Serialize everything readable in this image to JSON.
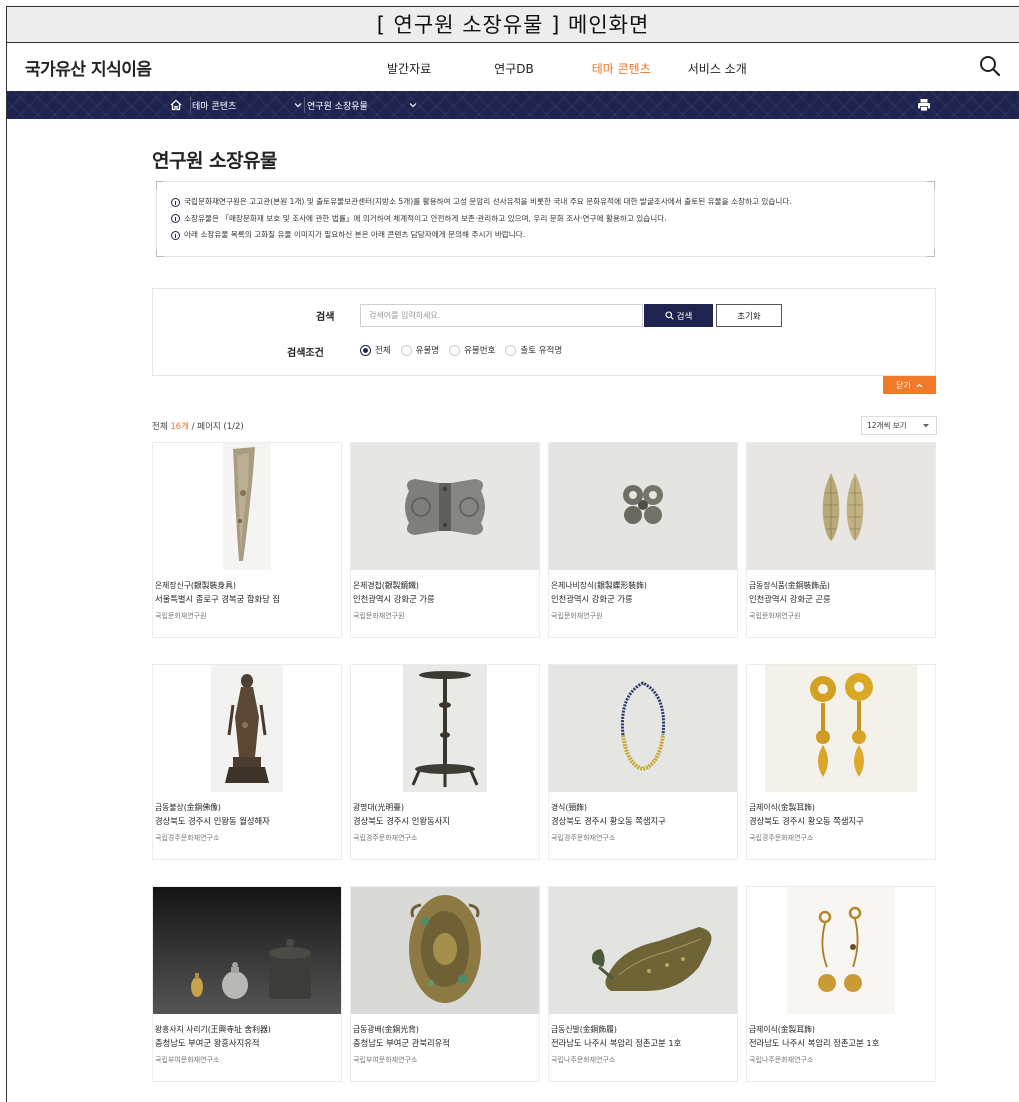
{
  "frame_title": "[ 연구원 소장유물 ] 메인화면",
  "logo": "국가유산 지식이음",
  "gnb": [
    {
      "label": "발간자료",
      "active": false
    },
    {
      "label": "연구DB",
      "active": false
    },
    {
      "label": "테마 콘텐츠",
      "active": true
    },
    {
      "label": "서비스 소개",
      "active": false
    }
  ],
  "location": {
    "dropdown1": "테마 콘텐츠",
    "dropdown2": "연구원 소장유물"
  },
  "page_title": "연구원 소장유물",
  "notice": [
    "국립문화재연구원은 고고관(본원 1개) 및 출토유물보관센터(지방소 5개)를 활용하여 고성 문암리 선사유적을 비롯한 국내 주요 문화유적에 대한 발굴조사에서 출토된 유물을 소장하고 있습니다.",
    "소장유물은 「매장문화재 보호 및 조사에 관한 법률」에 의거하여 체계적이고 안전하게 보존·관리하고 있으며, 우리 문화 조사·연구에 활용하고 있습니다.",
    "아래 소장유물 목록의 고화질 유물 이미지가 필요하신 분은 아래 콘텐츠 담당자에게 문의해 주시기 바랍니다."
  ],
  "search": {
    "label": "검색",
    "placeholder": "검색어를 입력하세요.",
    "search_button": "검색",
    "reset_button": "초기화",
    "condition_label": "검색조건",
    "conditions": [
      "전체",
      "유물명",
      "유물번호",
      "출토 유적명"
    ],
    "selected": "전체"
  },
  "close_button": "닫기",
  "total": {
    "prefix": "전체 ",
    "count": "16개",
    "suffix": " / 페이지 (1/2)"
  },
  "per_page": "12개씩 보기",
  "items": [
    {
      "title": "은제장신구(銀製裝身具)",
      "place": "서울특별시 종로구 경복궁 함화당 집",
      "inst": "국립문화재연구원"
    },
    {
      "title": "은제경첩(銀製鏡鐵)",
      "place": "인천광역시 강화군 가릉",
      "inst": "국립문화재연구원"
    },
    {
      "title": "은제나비장식(銀製蝶形裝飾)",
      "place": "인천광역시 강화군 가릉",
      "inst": "국립문화재연구원"
    },
    {
      "title": "금동장식품(金銅裝飾品)",
      "place": "인천광역시 강화군 곤릉",
      "inst": "국립문화재연구원"
    },
    {
      "title": "금동불상(金銅佛像)",
      "place": "경상북도 경주시 인왕동 월성해자",
      "inst": "국립경주문화재연구소"
    },
    {
      "title": "광명대(光明臺)",
      "place": "경상북도 경주시 인왕동사지",
      "inst": "국립경주문화재연구소"
    },
    {
      "title": "경식(頸飾)",
      "place": "경상북도 경주시 황오동 쪽샘지구",
      "inst": "국립경주문화재연구소"
    },
    {
      "title": "금제이식(金製耳飾)",
      "place": "경상북도 경주시 황오동 쪽샘지구",
      "inst": "국립경주문화재연구소"
    },
    {
      "title": "왕흥사지 사리기(王興寺址 舍利器)",
      "place": "충청남도 부여군 왕흥사지유적",
      "inst": "국립부여문화재연구소"
    },
    {
      "title": "금동광배(金銅光背)",
      "place": "충청남도 부여군 관북리유적",
      "inst": "국립부여문화재연구소"
    },
    {
      "title": "금동신발(金銅飾履)",
      "place": "전라남도 나주시 복암리 정촌고분 1호",
      "inst": "국립나주문화재연구소"
    },
    {
      "title": "금제이식(金製耳飾)",
      "place": "전라남도 나주시 복암리 정촌고분 1호",
      "inst": "국립나주문화재연구소"
    }
  ],
  "colors": {
    "navy": "#1e2350",
    "accent": "#e8742a",
    "close_btn": "#f07a2a"
  }
}
